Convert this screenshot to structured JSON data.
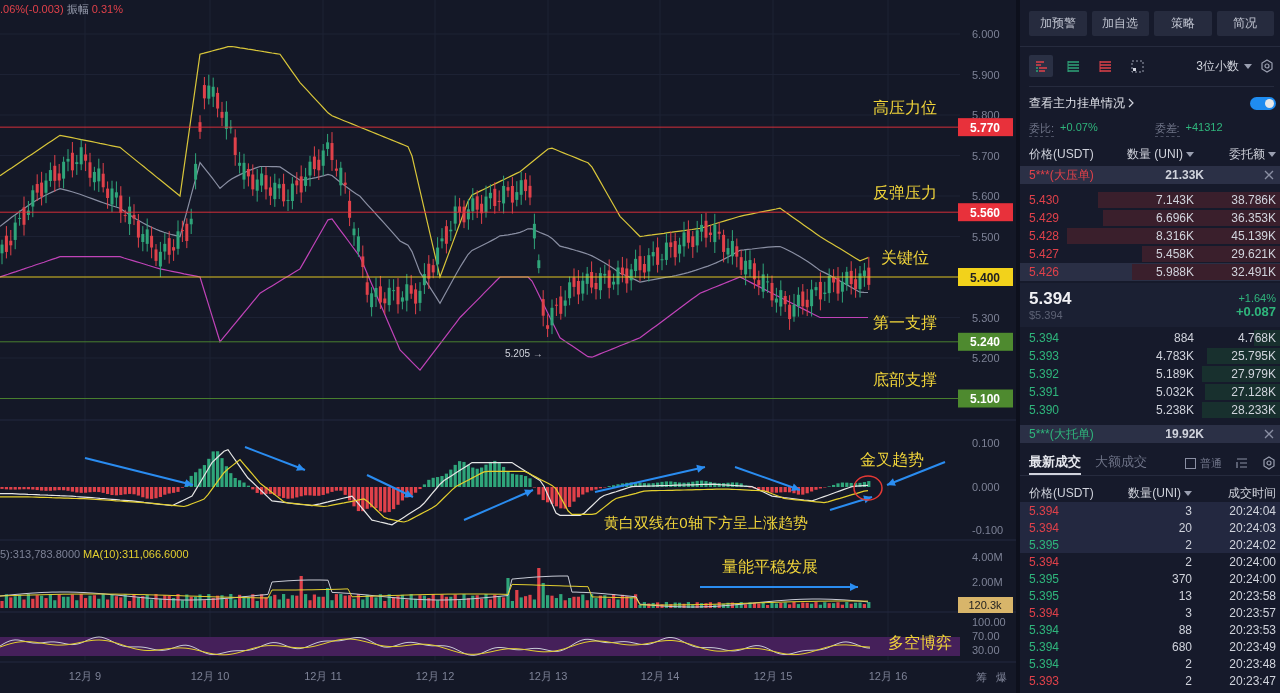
{
  "header_stats": {
    "change": ".06%(-0.003)",
    "amplitude_label": "振幅",
    "amplitude": "0.31%"
  },
  "price_axis": [
    "6.000",
    "5.900",
    "5.800",
    "5.700",
    "5.600",
    "5.500",
    "5.300",
    "5.200"
  ],
  "price_levels": [
    {
      "price": "5.770",
      "label": "高压力位",
      "color": "#e8313b"
    },
    {
      "price": "5.560",
      "label": "反弹压力",
      "color": "#e8313b"
    },
    {
      "price": "5.400",
      "label": "关键位",
      "color": "#f2d21b"
    },
    {
      "price": "5.240",
      "label": "第一支撑",
      "color": "#4e8a2f"
    },
    {
      "price": "5.100",
      "label": "底部支撑",
      "color": "#4e8a2f"
    }
  ],
  "low_marker": "5.205 →",
  "macd_axis": [
    "0.100",
    "0.000",
    "-0.100"
  ],
  "macd_annotations": [
    "金叉趋势",
    "黄白双线在0轴下方呈上涨趋势"
  ],
  "volume_legend": [
    "5):313,783.8000",
    "MA(10):311,066.6000"
  ],
  "volume_axis": [
    "4.00M",
    "2.00M"
  ],
  "volume_tag": "120.3k",
  "volume_annotation": "量能平稳发展",
  "rsi_axis": [
    "100.00",
    "70.00",
    "30.00"
  ],
  "rsi_annotation": "多空博弈",
  "date_axis": [
    "12月 9",
    "12月 10",
    "12月 11",
    "12月 12",
    "12月 13",
    "12月 14",
    "12月 15",
    "12月 16"
  ],
  "corner_labels": [
    "筹",
    "爆"
  ],
  "actions": [
    "加预警",
    "加自选",
    "策略",
    "简况"
  ],
  "view_modes": [
    {
      "kind": "both",
      "selected": true
    },
    {
      "kind": "bids",
      "selected": false
    },
    {
      "kind": "asks",
      "selected": false
    },
    {
      "kind": "depth",
      "selected": false
    }
  ],
  "precision": "3位小数",
  "main_orders": {
    "label": "查看主力挂单情况",
    "on": true
  },
  "ratio": {
    "label": "委比:",
    "value": "+0.07%"
  },
  "diff": {
    "label": "委差:",
    "value": "+41312"
  },
  "book_columns": [
    {
      "label": "价格(USDT)",
      "caret": false
    },
    {
      "label": "数量 (UNI)",
      "caret": true
    },
    {
      "label": "委托额",
      "caret": true
    }
  ],
  "big_ask": {
    "label": "5***(大压单)",
    "amount": "21.33K"
  },
  "asks": [
    {
      "price": "5.430",
      "qty": "7.143K",
      "total": "38.786K",
      "level": 0.7,
      "highlighted": false
    },
    {
      "price": "5.429",
      "qty": "6.696K",
      "total": "36.353K",
      "level": 0.68,
      "highlighted": false
    },
    {
      "price": "5.428",
      "qty": "8.316K",
      "total": "45.139K",
      "level": 0.82,
      "highlighted": false
    },
    {
      "price": "5.427",
      "qty": "5.458K",
      "total": "29.621K",
      "level": 0.53,
      "highlighted": false
    },
    {
      "price": "5.426",
      "qty": "5.988K",
      "total": "32.491K",
      "level": 0.57,
      "highlighted": true
    }
  ],
  "last": {
    "price": "5.394",
    "usd": "$5.394",
    "change_pct": "+1.64%",
    "change": "+0.087"
  },
  "bids": [
    {
      "price": "5.394",
      "qty": "884",
      "total": "4.768K",
      "level": 0.1,
      "highlighted": false
    },
    {
      "price": "5.393",
      "qty": "4.783K",
      "total": "25.795K",
      "level": 0.28,
      "highlighted": false
    },
    {
      "price": "5.392",
      "qty": "5.189K",
      "total": "27.979K",
      "level": 0.3,
      "highlighted": false
    },
    {
      "price": "5.391",
      "qty": "5.032K",
      "total": "27.128K",
      "level": 0.29,
      "highlighted": false
    },
    {
      "price": "5.390",
      "qty": "5.238K",
      "total": "28.233K",
      "level": 0.3,
      "highlighted": false
    }
  ],
  "big_bid": {
    "label": "5***(大托单)",
    "amount": "19.92K"
  },
  "trade_tabs": [
    {
      "label": "最新成交",
      "selected": true
    },
    {
      "label": "大额成交",
      "selected": false
    }
  ],
  "normal_filter": {
    "label": "普通",
    "checked": false
  },
  "trade_columns": [
    {
      "label": "价格(USDT)",
      "caret": false
    },
    {
      "label": "数量(UNI)",
      "caret": true
    },
    {
      "label": "成交时间",
      "caret": false
    }
  ],
  "trades": [
    {
      "price": "5.394",
      "qty": "3",
      "time": "20:24:04",
      "buy": false,
      "highlighted": true
    },
    {
      "price": "5.394",
      "qty": "20",
      "time": "20:24:03",
      "buy": false,
      "highlighted": true
    },
    {
      "price": "5.395",
      "qty": "2",
      "time": "20:24:02",
      "buy": true,
      "highlighted": true
    },
    {
      "price": "5.394",
      "qty": "2",
      "time": "20:24:00",
      "buy": false,
      "highlighted": false
    },
    {
      "price": "5.395",
      "qty": "370",
      "time": "20:24:00",
      "buy": true,
      "highlighted": false
    },
    {
      "price": "5.395",
      "qty": "13",
      "time": "20:23:58",
      "buy": true,
      "highlighted": false
    },
    {
      "price": "5.394",
      "qty": "3",
      "time": "20:23:57",
      "buy": false,
      "highlighted": false
    },
    {
      "price": "5.394",
      "qty": "88",
      "time": "20:23:53",
      "buy": true,
      "highlighted": false
    },
    {
      "price": "5.394",
      "qty": "680",
      "time": "20:23:49",
      "buy": true,
      "highlighted": false
    },
    {
      "price": "5.394",
      "qty": "2",
      "time": "20:23:48",
      "buy": true,
      "highlighted": false
    },
    {
      "price": "5.393",
      "qty": "2",
      "time": "20:23:47",
      "buy": false,
      "highlighted": false
    }
  ]
}
